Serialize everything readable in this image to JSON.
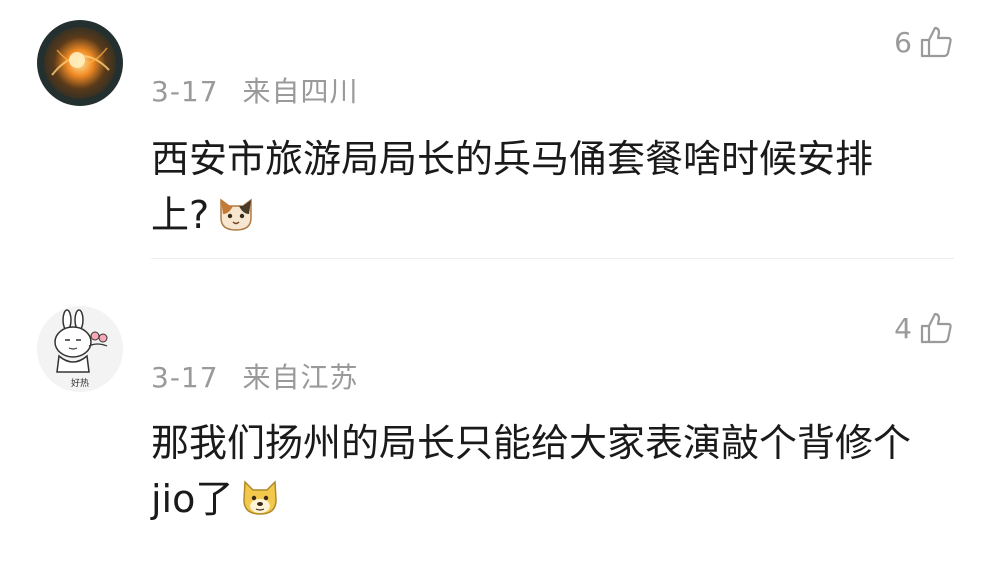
{
  "comments": [
    {
      "date": "3-17",
      "location": "来自四川",
      "likes": "6",
      "line1": "西安市旅游局局长的兵马俑套餐啥时候安排",
      "line2": "上?",
      "avatar_icon": "fire-orb-avatar",
      "emoji": "cat-face-emoji"
    },
    {
      "date": "3-17",
      "location": "来自江苏",
      "likes": "4",
      "line1": "那我们扬州的局长只能给大家表演敲个背修个",
      "line2": "jio了",
      "avatar_icon": "bunny-sticker-avatar",
      "avatar_caption": "好热",
      "emoji": "doge-emoji"
    }
  ]
}
